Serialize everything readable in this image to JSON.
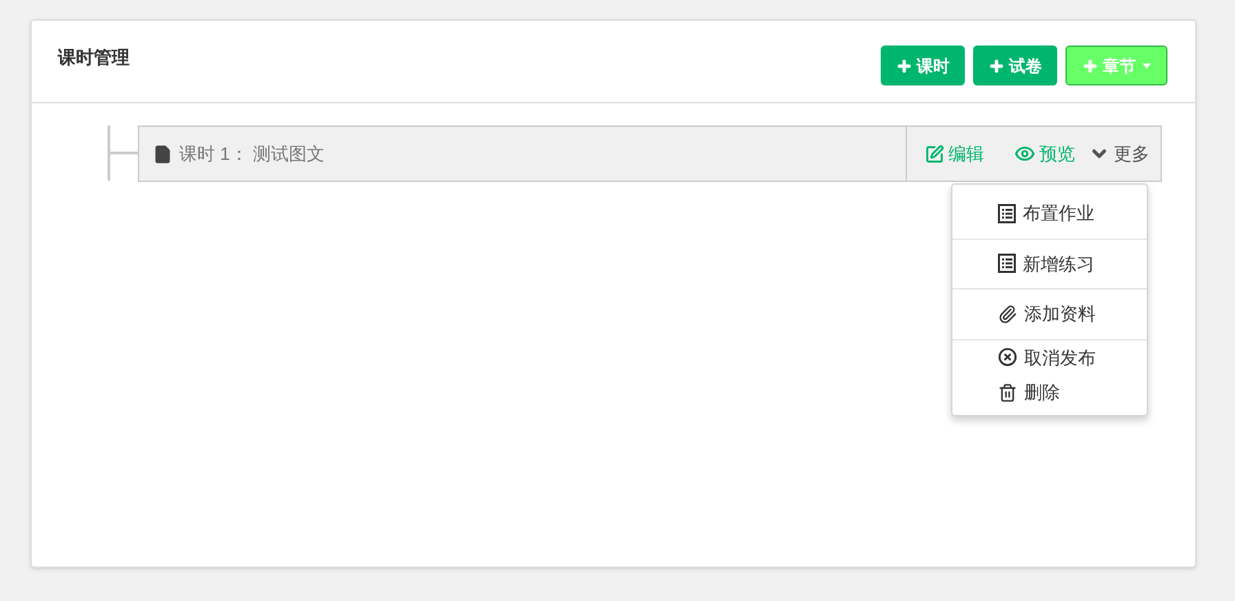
{
  "panel": {
    "title": "课时管理"
  },
  "buttons": [
    {
      "label": "课时",
      "kind": "primary"
    },
    {
      "label": "试卷",
      "kind": "primary"
    },
    {
      "label": "章节",
      "kind": "dropdown"
    }
  ],
  "lesson": {
    "prefix": "课时 1：",
    "name": "测试图文",
    "actions": [
      {
        "label": "编辑",
        "kind": "edit"
      },
      {
        "label": "预览",
        "kind": "view"
      },
      {
        "label": "更多",
        "kind": "more"
      }
    ]
  },
  "menu": [
    {
      "label": "布置作业",
      "kind": "task",
      "divider": true
    },
    {
      "label": "新增练习",
      "kind": "task",
      "divider": true
    },
    {
      "label": "添加资料",
      "kind": "attach",
      "divider": true
    },
    {
      "label": "取消发布",
      "kind": "cancel",
      "divider": false
    },
    {
      "label": "删除",
      "kind": "delete",
      "divider": false
    }
  ]
}
